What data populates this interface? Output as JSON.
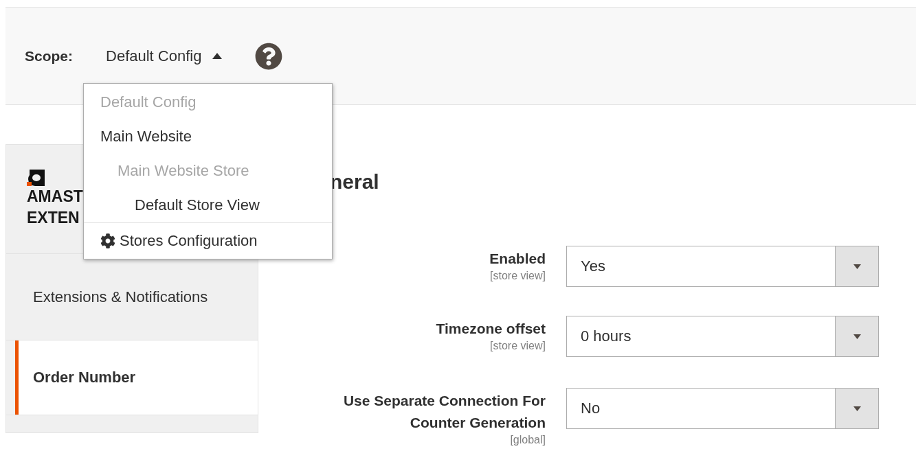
{
  "scope": {
    "label": "Scope:",
    "value": "Default Config",
    "expanded": true
  },
  "scope_menu": {
    "items": [
      {
        "label": "Default Config",
        "disabled": true
      },
      {
        "label": "Main Website",
        "disabled": false,
        "children": [
          {
            "label": "Main Website Store",
            "disabled": true,
            "children": [
              {
                "label": "Default Store View",
                "disabled": false
              }
            ]
          }
        ]
      }
    ],
    "action": "Stores Configuration"
  },
  "sidebar": {
    "logo_lines": [
      "AMAST",
      "EXTEN"
    ],
    "items": [
      {
        "label": "Extensions & Notifications",
        "selected": false
      },
      {
        "label": "Order Number",
        "selected": true
      }
    ]
  },
  "section": {
    "title": "neral"
  },
  "fields": [
    {
      "label": "Enabled",
      "scope": "[store view]",
      "value": "Yes"
    },
    {
      "label": "Timezone offset",
      "scope": "[store view]",
      "value": "0 hours"
    },
    {
      "label": "Use Separate Connection For Counter Generation",
      "scope": "[global]",
      "value": "No"
    }
  ]
}
